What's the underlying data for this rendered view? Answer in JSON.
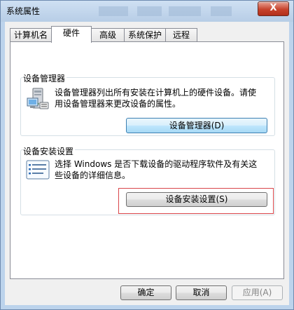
{
  "window": {
    "title": "系统属性",
    "close_glyph": "X"
  },
  "tabs": [
    {
      "label": "计算机名",
      "active": false
    },
    {
      "label": "硬件",
      "active": true
    },
    {
      "label": "高级",
      "active": false
    },
    {
      "label": "系统保护",
      "active": false
    },
    {
      "label": "远程",
      "active": false
    }
  ],
  "device_manager": {
    "heading": "设备管理器",
    "description_line1": "设备管理器列出所有安装在计算机上的硬件设备。请使",
    "description_line2": "用设备管理器来更改设备的属性。",
    "button_label": "设备管理器(D)",
    "icon": "device-manager-icon"
  },
  "device_installation": {
    "heading": "设备安装设置",
    "description_line1": "选择 Windows 是否下载设备的驱动程序软件及有关这",
    "description_line2": "些设备的详细信息。",
    "button_label": "设备安装设置(S)",
    "icon": "checklist-icon"
  },
  "footer": {
    "ok_label": "确定",
    "cancel_label": "取消",
    "apply_label": "应用(A)"
  },
  "colors": {
    "highlight": "#d9464a",
    "focus_border": "#3c7fb1",
    "close_button": "#c7432c"
  }
}
